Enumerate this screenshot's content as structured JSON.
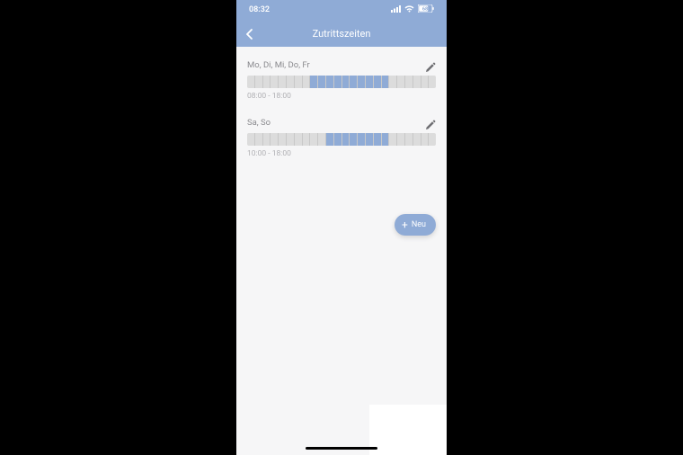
{
  "status": {
    "time": "08:32",
    "signal": "••••",
    "battery": "68"
  },
  "nav": {
    "title": "Zutrittszeiten"
  },
  "entries": [
    {
      "days": "Mo, Di, Mi, Do, Fr",
      "range": "08:00 - 18:00",
      "start_pct": 33.3,
      "end_pct": 75
    },
    {
      "days": "Sa, So",
      "range": "10:00 - 18:00",
      "start_pct": 41.7,
      "end_pct": 75
    }
  ],
  "fab": {
    "label": "Neu"
  }
}
